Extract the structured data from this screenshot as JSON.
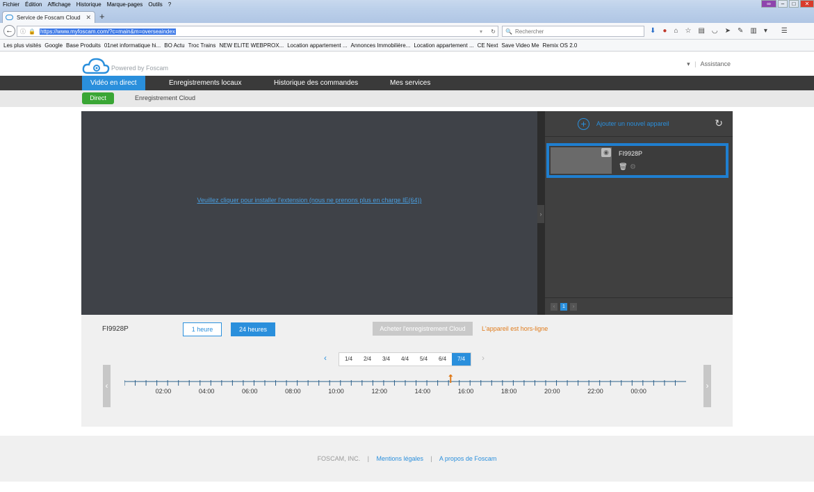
{
  "browser": {
    "menu": [
      "Fichier",
      "Édition",
      "Affichage",
      "Historique",
      "Marque-pages",
      "Outils",
      "?"
    ],
    "tab_title": "Service de Foscam Cloud",
    "url": "https://www.myfoscam.com/?c=main&m=overseaindex",
    "search_placeholder": "Rechercher",
    "bookmarks": [
      "Les plus visités",
      "Google",
      "Base Produits",
      "01net informatique hi...",
      "BO Actu",
      "Troc Trains",
      "NEW ELITE WEBPROX...",
      "Location appartement ...",
      "Annonces Immobilière...",
      "Location appartement ...",
      "CE Next",
      "Save Video Me",
      "Remix OS 2.0"
    ]
  },
  "header": {
    "powered_by": "Powered by Foscam",
    "assistance": "Assistance"
  },
  "main_nav": [
    "Vidéo en direct",
    "Enregistrements locaux",
    "Historique des commandes",
    "Mes services"
  ],
  "sub_nav": {
    "direct": "Direct",
    "cloud": "Enregistrement Cloud"
  },
  "video": {
    "install_link": "Veuillez cliquer pour installer l'extension (nous ne prenons plus en charge IE(64))"
  },
  "devices": {
    "add_label": "Ajouter un nouvel appareil",
    "items": [
      {
        "name": "FI9928P"
      }
    ],
    "page": "1"
  },
  "controls": {
    "device_name": "FI9928P",
    "btn_1h": "1 heure",
    "btn_24h": "24 heures",
    "buy_cloud": "Acheter l'enregistrement Cloud",
    "offline": "L'appareil est hors-ligne",
    "days": [
      "1/4",
      "2/4",
      "3/4",
      "4/4",
      "5/4",
      "6/4",
      "7/4"
    ],
    "active_day": "7/4",
    "timeline_labels": [
      "02:00",
      "04:00",
      "06:00",
      "08:00",
      "10:00",
      "12:00",
      "14:00",
      "16:00",
      "18:00",
      "20:00",
      "22:00",
      "00:00"
    ],
    "current_marker_hour": 15.3
  },
  "footer": {
    "company": "FOSCAM, INC.",
    "legal": "Mentions légales",
    "about": "A propos de Foscam"
  },
  "colors": {
    "accent": "#2a8fdc",
    "green": "#3aa635",
    "offline": "#e07b1b"
  }
}
